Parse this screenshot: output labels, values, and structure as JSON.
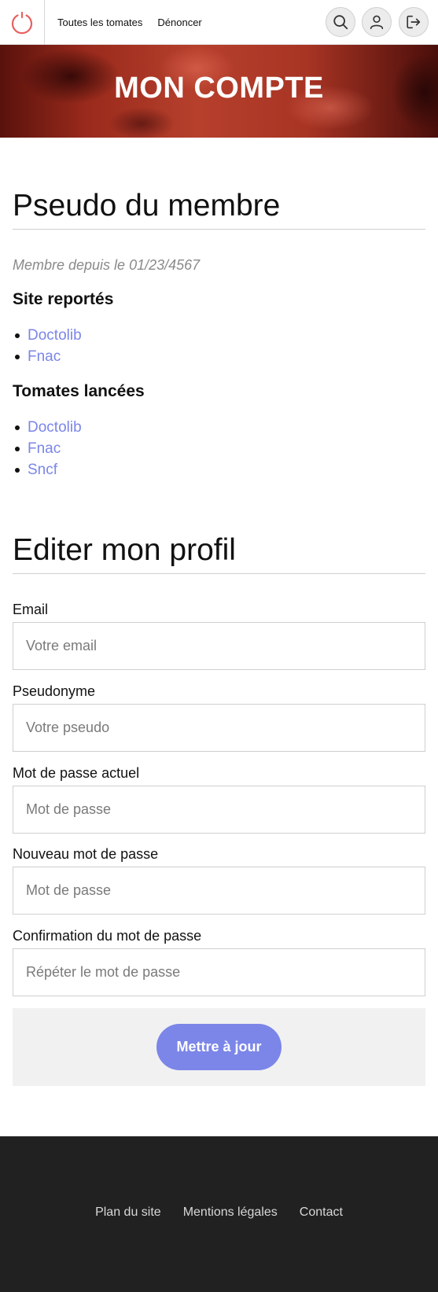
{
  "header": {
    "nav": [
      "Toutes les tomates",
      "Dénoncer"
    ],
    "icons": [
      "power-logo-icon",
      "search-icon",
      "user-icon",
      "logout-icon"
    ],
    "accent_color": "#e86060"
  },
  "hero": {
    "title": "MON COMPTE"
  },
  "profile": {
    "title": "Pseudo du membre",
    "member_since": "Membre depuis le 01/23/4567",
    "reported_heading": "Site reportés",
    "reported_sites": [
      "Doctolib",
      "Fnac"
    ],
    "tomatoes_heading": "Tomates lancées",
    "tomatoes_sites": [
      "Doctolib",
      "Fnac",
      "Sncf"
    ]
  },
  "edit": {
    "title": "Editer mon profil",
    "fields": [
      {
        "label": "Email",
        "placeholder": "Votre email",
        "value": ""
      },
      {
        "label": "Pseudonyme",
        "placeholder": "Votre pseudo",
        "value": ""
      },
      {
        "label": "Mot de passe actuel",
        "placeholder": "Mot de passe",
        "value": ""
      },
      {
        "label": "Nouveau mot de passe",
        "placeholder": "Mot de passe",
        "value": ""
      },
      {
        "label": "Confirmation du mot de passe",
        "placeholder": "Répéter le mot de passe",
        "value": ""
      }
    ],
    "submit_label": "Mettre à jour"
  },
  "footer": {
    "links": [
      "Plan du site",
      "Mentions légales",
      "Contact"
    ]
  },
  "colors": {
    "link": "#7b86e8",
    "button": "#7b86e8",
    "footer_bg": "#212121"
  }
}
